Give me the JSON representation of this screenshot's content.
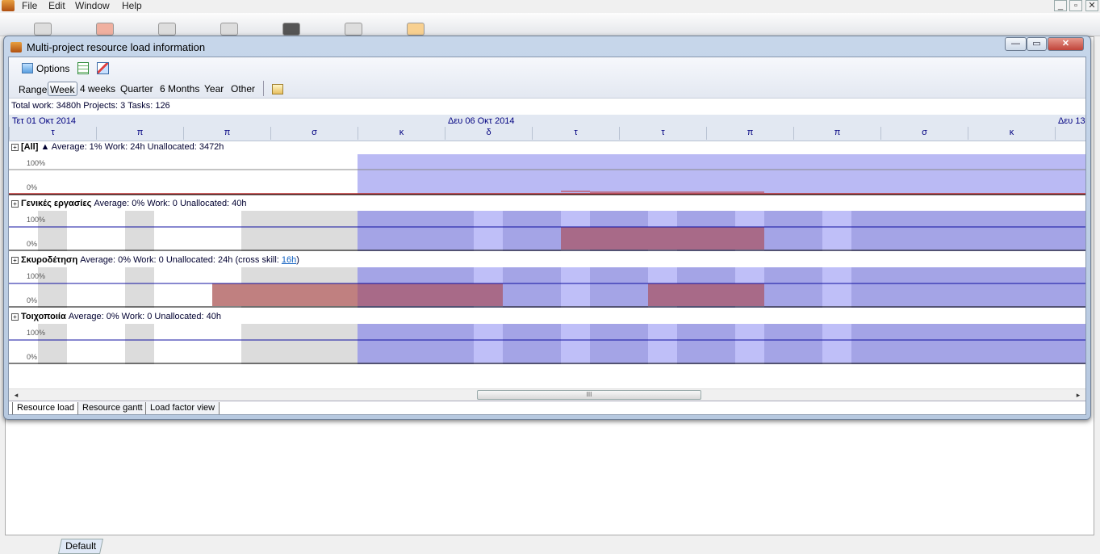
{
  "menu": [
    "File",
    "Edit",
    "Window",
    "Help"
  ],
  "app_window_controls": [
    "_",
    "▫",
    "✕"
  ],
  "dialog": {
    "title": "Multi-project resource load information",
    "controls": {
      "minimize": "—",
      "maximize": "▭",
      "close": "✕"
    }
  },
  "toolbar": {
    "options_label": "Options",
    "range_label": "Range",
    "ranges": [
      "Week",
      "4 weeks",
      "Quarter",
      "6 Months",
      "Year",
      "Other"
    ],
    "selected_range": "Week"
  },
  "summary": "Total work: 3480h  Projects: 3  Tasks: 126",
  "timeline": {
    "dates": [
      "Τετ 01 Οκτ 2014",
      "Δευ 06 Οκτ 2014",
      "Δευ 13"
    ],
    "days": [
      "τ",
      "π",
      "π",
      "σ",
      "κ",
      "δ",
      "τ",
      "τ",
      "π",
      "π",
      "σ",
      "κ"
    ]
  },
  "rows": [
    {
      "name": "[All]",
      "sort_icon": "▲",
      "stats": "Average: 1% Work: 24h Unallocated: 3472h",
      "skill_link": ""
    },
    {
      "name": "Γενικές εργασίες",
      "stats": "Average: 0% Work: 0 Unallocated: 40h",
      "skill_link": ""
    },
    {
      "name": "Σκυροδέτηση",
      "stats": "Average: 0% Work: 0 Unallocated: 24h (cross skill: ",
      "skill_link": "16h",
      "stats_end": ")"
    },
    {
      "name": "Τοιχοποιία",
      "stats": "Average: 0% Work: 0 Unallocated: 40h",
      "skill_link": ""
    }
  ],
  "pct_labels": {
    "top": "100%",
    "bottom": "0%"
  },
  "scrollbar": {
    "left_arrow": "◂",
    "right_arrow": "▸",
    "grip": "III"
  },
  "view_tabs": [
    "Resource load",
    "Resource gantt",
    "Load factor view"
  ],
  "bottom_tab": "Default",
  "colors": {
    "weekend": "#dcdcdc",
    "future_light": "#bfbff8",
    "future_dark": "#a4a4e6",
    "overload": "#c08080",
    "overload_dark": "#a86a88",
    "baseline": "#1010a0",
    "all_bg": "#babaf4"
  }
}
